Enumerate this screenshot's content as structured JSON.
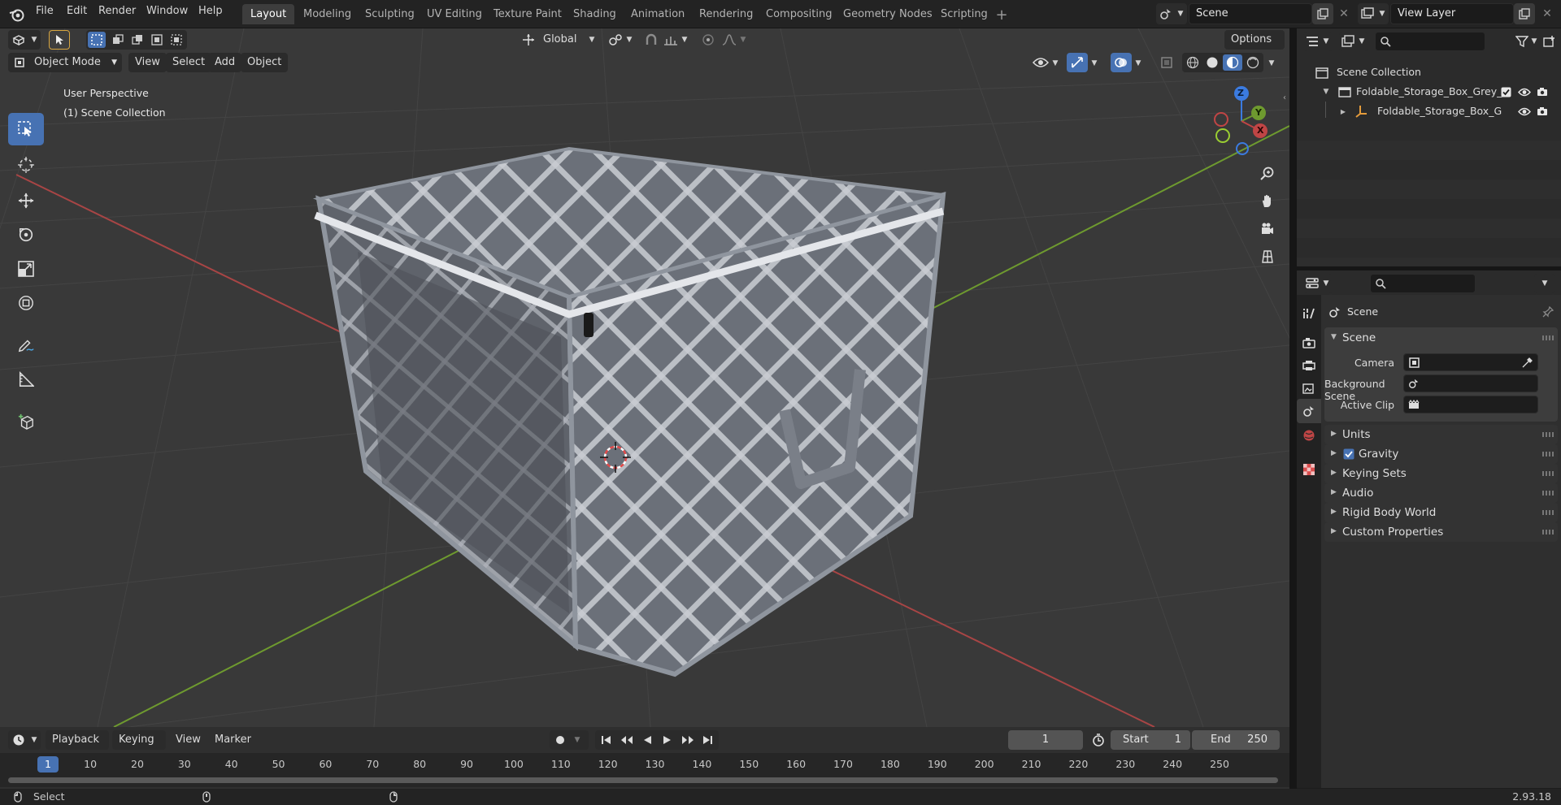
{
  "topbar": {
    "menus": [
      "File",
      "Edit",
      "Render",
      "Window",
      "Help"
    ],
    "workspaces": [
      "Layout",
      "Modeling",
      "Sculpting",
      "UV Editing",
      "Texture Paint",
      "Shading",
      "Animation",
      "Rendering",
      "Compositing",
      "Geometry Nodes",
      "Scripting"
    ],
    "active_workspace": "Layout",
    "scene_name": "Scene",
    "view_layer_name": "View Layer"
  },
  "viewport": {
    "transform_orientation": "Global",
    "options_label": "Options",
    "mode": "Object Mode",
    "menus": [
      "View",
      "Select",
      "Add",
      "Object"
    ],
    "perspective_label": "User Perspective",
    "collection_label": "(1) Scene Collection",
    "gizmo_axes": [
      "Z",
      "Y",
      "X"
    ]
  },
  "outliner": {
    "root": "Scene Collection",
    "items": [
      {
        "label": "Foldable_Storage_Box_Grey_"
      },
      {
        "label": "Foldable_Storage_Box_G"
      }
    ]
  },
  "properties": {
    "context_title": "Scene",
    "panel_title": "Scene",
    "fields": [
      {
        "label": "Camera"
      },
      {
        "label": "Background Scene"
      },
      {
        "label": "Active Clip"
      }
    ],
    "sections": [
      "Units",
      "Gravity",
      "Keying Sets",
      "Audio",
      "Rigid Body World",
      "Custom Properties"
    ],
    "gravity_checked": true
  },
  "timeline": {
    "menus": [
      "Playback",
      "Keying",
      "View",
      "Marker"
    ],
    "current_frame": "1",
    "start_label": "Start",
    "start_value": "1",
    "end_label": "End",
    "end_value": "250",
    "ruler_ticks": [
      "1",
      "10",
      "20",
      "30",
      "40",
      "50",
      "60",
      "70",
      "80",
      "90",
      "100",
      "110",
      "120",
      "130",
      "140",
      "150",
      "160",
      "170",
      "180",
      "190",
      "200",
      "210",
      "220",
      "230",
      "240",
      "250"
    ]
  },
  "statusbar": {
    "left_label": "Select",
    "version": "2.93.18"
  },
  "colors": {
    "accent": "#4772b3",
    "axis_x": "#c04545",
    "axis_y": "#6e9a2f",
    "axis_z": "#3b7be0"
  }
}
